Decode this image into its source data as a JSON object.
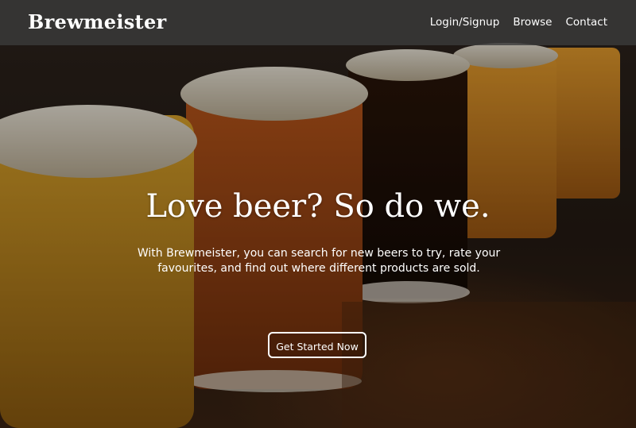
{
  "navbar": {
    "brand": "Brewmeister",
    "links": [
      {
        "label": "Login/Signup"
      },
      {
        "label": "Browse"
      },
      {
        "label": "Contact"
      }
    ]
  },
  "hero": {
    "title": "Love beer? So do we.",
    "text": "With Brewmeister, you can search for new beers to try, rate your favourites, and find out where different products are sold.",
    "cta_label": "Get Started Now",
    "background": "photo of a flight of beer glasses on a wooden bar"
  },
  "colors": {
    "navbar_bg": "#3a3a3a",
    "text": "#ffffff",
    "amber_beer": "#c07a18",
    "dark_beer": "#1d1109",
    "wood": "#5a3115"
  }
}
